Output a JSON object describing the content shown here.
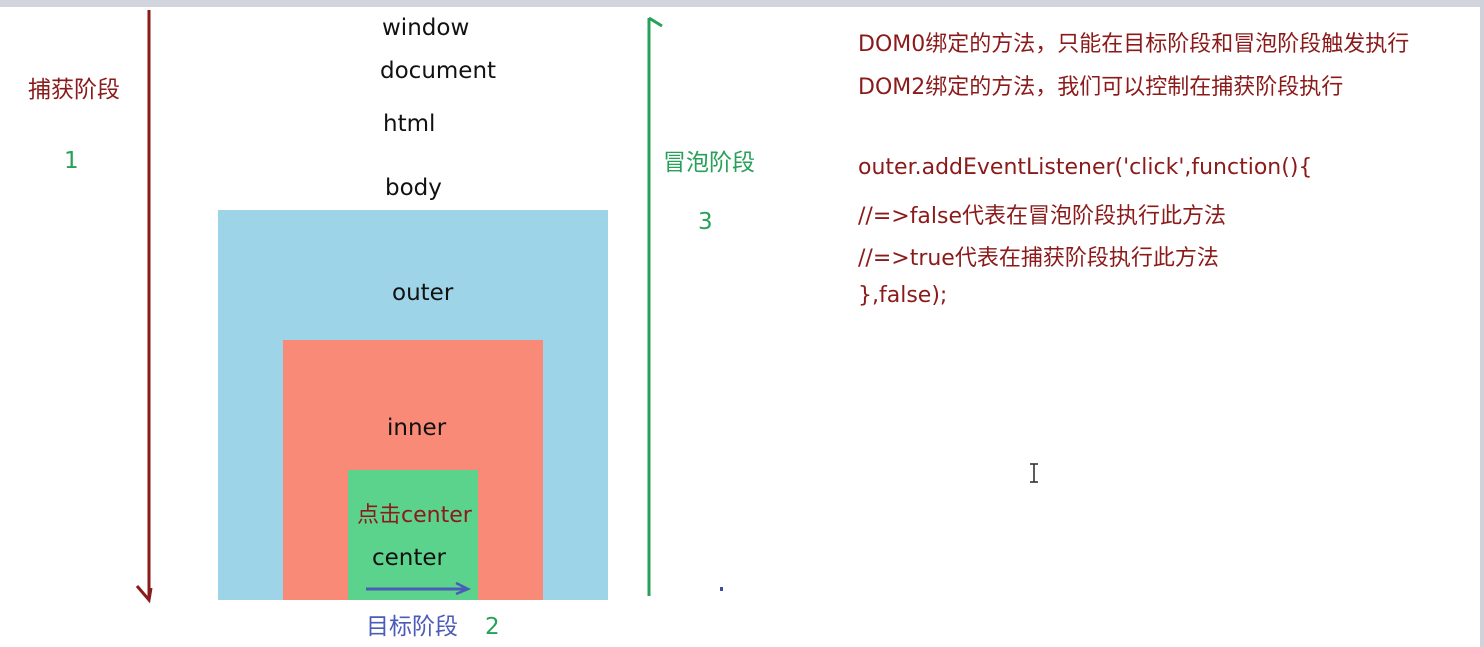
{
  "phases": {
    "capture_label": "捕获阶段",
    "capture_number": "1",
    "bubble_label": "冒泡阶段",
    "bubble_number": "3",
    "target_label": "目标阶段",
    "target_number": "2"
  },
  "dom_levels": [
    "window",
    "document",
    "html",
    "body"
  ],
  "boxes": {
    "outer": "outer",
    "inner": "inner",
    "click_text": "点击center",
    "center": "center"
  },
  "notes": [
    "DOM0绑定的方法，只能在目标阶段和冒泡阶段触发执行",
    "DOM2绑定的方法，我们可以控制在捕获阶段执行"
  ],
  "code_lines": [
    "outer.addEventListener('click',function(){",
    "//=>false代表在冒泡阶段执行此方法",
    "//=>true代表在捕获阶段执行此方法",
    "},false);"
  ],
  "colors": {
    "capture_arrow": "#8b1a1a",
    "bubble_arrow": "#27a158",
    "target_arrow": "#4b5bb8",
    "outer_fill": "#9ed4e8",
    "inner_fill": "#f98a78",
    "center_fill": "#5cd38d"
  }
}
